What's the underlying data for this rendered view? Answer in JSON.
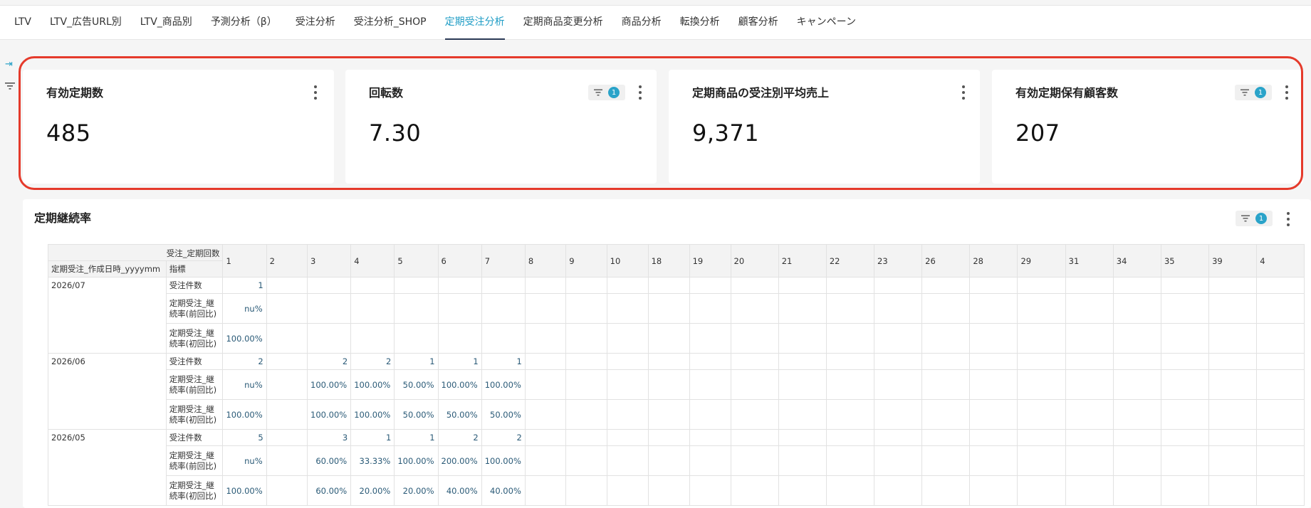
{
  "tabs": [
    {
      "label": "LTV"
    },
    {
      "label": "LTV_広告URL別"
    },
    {
      "label": "LTV_商品別"
    },
    {
      "label": "予測分析（β）"
    },
    {
      "label": "受注分析"
    },
    {
      "label": "受注分析_SHOP"
    },
    {
      "label": "定期受注分析",
      "active": true
    },
    {
      "label": "定期商品変更分析"
    },
    {
      "label": "商品分析"
    },
    {
      "label": "転換分析"
    },
    {
      "label": "顧客分析"
    },
    {
      "label": "キャンペーン"
    }
  ],
  "kpis": [
    {
      "title": "有効定期数",
      "value": "485",
      "filter_count": null
    },
    {
      "title": "回転数",
      "value": "7.30",
      "filter_count": "1"
    },
    {
      "title": "定期商品の受注別平均売上",
      "value": "9,371",
      "filter_count": null
    },
    {
      "title": "有効定期保有顧客数",
      "value": "207",
      "filter_count": "1"
    }
  ],
  "retention": {
    "title": "定期継続率",
    "filter_count": "1",
    "col_dim_label": "受注_定期回数",
    "row_dim_label": "定期受注_作成日時_yyyymm",
    "metric_label": "指標",
    "columns": [
      "1",
      "2",
      "3",
      "4",
      "5",
      "6",
      "7",
      "8",
      "9",
      "10",
      "18",
      "19",
      "20",
      "21",
      "22",
      "23",
      "26",
      "28",
      "29",
      "31",
      "34",
      "35",
      "39",
      "4"
    ],
    "groups": [
      {
        "period": "2026/07",
        "rows": [
          {
            "metric": "受注件数",
            "values": [
              "1",
              "",
              "",
              "",
              "",
              "",
              ""
            ]
          },
          {
            "metric": "定期受注_継続率(前回比)",
            "values": [
              "nu%",
              "",
              "",
              "",
              "",
              "",
              ""
            ]
          },
          {
            "metric": "定期受注_継続率(初回比)",
            "values": [
              "100.00%",
              "",
              "",
              "",
              "",
              "",
              ""
            ]
          }
        ]
      },
      {
        "period": "2026/06",
        "rows": [
          {
            "metric": "受注件数",
            "values": [
              "2",
              "",
              "2",
              "2",
              "1",
              "1",
              "1"
            ]
          },
          {
            "metric": "定期受注_継続率(前回比)",
            "values": [
              "nu%",
              "",
              "100.00%",
              "100.00%",
              "50.00%",
              "100.00%",
              "100.00%"
            ]
          },
          {
            "metric": "定期受注_継続率(初回比)",
            "values": [
              "100.00%",
              "",
              "100.00%",
              "100.00%",
              "50.00%",
              "50.00%",
              "50.00%"
            ]
          }
        ]
      },
      {
        "period": "2026/05",
        "rows": [
          {
            "metric": "受注件数",
            "values": [
              "5",
              "",
              "3",
              "1",
              "1",
              "2",
              "2"
            ]
          },
          {
            "metric": "定期受注_継続率(前回比)",
            "values": [
              "nu%",
              "",
              "60.00%",
              "33.33%",
              "100.00%",
              "200.00%",
              "100.00%"
            ]
          },
          {
            "metric": "定期受注_継続率(初回比)",
            "values": [
              "100.00%",
              "",
              "60.00%",
              "20.00%",
              "20.00%",
              "40.00%",
              "40.00%"
            ]
          }
        ]
      }
    ]
  }
}
